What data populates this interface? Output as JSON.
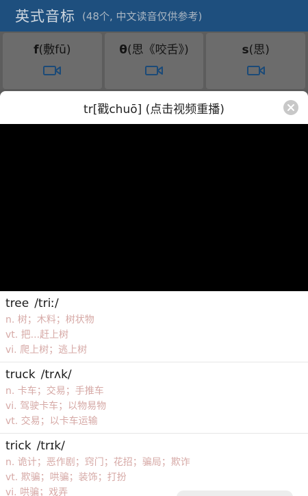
{
  "header": {
    "title": "英式音标",
    "subtitle": "(48个, 中文读音仅供参考)"
  },
  "phonemes": [
    {
      "symbol": "f",
      "hint": "(敷fū)"
    },
    {
      "symbol": "θ",
      "hint": "(思《咬舌》)"
    },
    {
      "symbol": "s",
      "hint": "(思)"
    }
  ],
  "sheet": {
    "title": "tr[戳chuō] (点击视频重播)"
  },
  "words": [
    {
      "word": "tree",
      "phonetic": "/triː/",
      "defs": [
        "n. 树；木料；树状物",
        "vt. 把...赶上树",
        "vi. 爬上树；逃上树"
      ]
    },
    {
      "word": "truck",
      "phonetic": "/trʌk/",
      "defs": [
        "n. 卡车；交易；手推车",
        "vi. 驾驶卡车；以物易物",
        "vt. 交易；以卡车运输"
      ]
    },
    {
      "word": "trick",
      "phonetic": "/trɪk/",
      "defs": [
        "n. 诡计；恶作剧；窍门；花招；骗局；欺诈",
        "vt. 欺骗；哄骗；装饰；打扮",
        "vi. 哄骗；戏弄"
      ]
    }
  ],
  "colors": {
    "header_bg": "#1e4f7e",
    "accent": "#2a6db0",
    "definition_text": "#d6a9a6"
  },
  "icons": {
    "video": "video-camera-icon",
    "close": "close-icon"
  }
}
